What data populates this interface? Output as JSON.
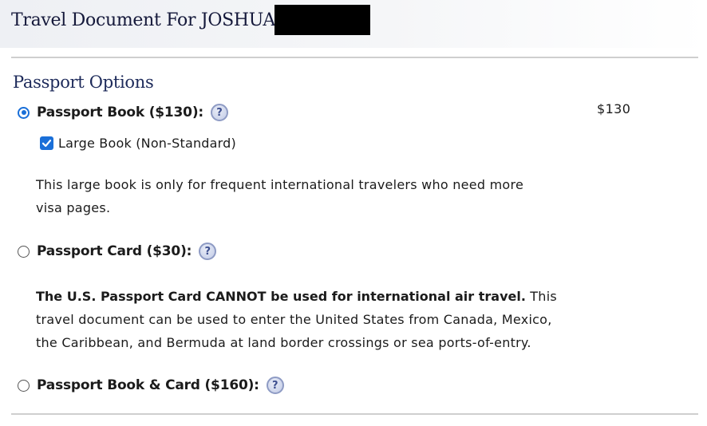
{
  "header": {
    "title": "Travel Document For JOSHUA"
  },
  "section": {
    "title": "Passport Options"
  },
  "options": [
    {
      "label": "Passport Book ($130):",
      "selected": true,
      "price": "$130",
      "addon": {
        "label": "Large Book (Non-Standard)",
        "checked": true
      },
      "description_lines": [
        "This large book is only for frequent international travelers who need more",
        "visa pages."
      ]
    },
    {
      "label": "Passport Card ($30):",
      "selected": false,
      "description_bold": "The U.S. Passport Card CANNOT be used for international air travel.",
      "description_lines": [
        " This",
        "travel document can be used to enter the United States from Canada, Mexico,",
        "the Caribbean, and Bermuda at land border crossings or sea ports-of-entry."
      ]
    },
    {
      "label": "Passport Book & Card ($160):",
      "selected": false
    }
  ],
  "help_icon_glyph": "?",
  "colors": {
    "accent": "#1a6fd8",
    "title": "#14183a",
    "section_title": "#1d2a5a",
    "help_icon_border": "#8e9bc4",
    "divider": "#cfcfcf",
    "redaction": "#000000"
  },
  "icons": {
    "help": "question-circle-icon",
    "checkbox": "checkmark-icon"
  }
}
